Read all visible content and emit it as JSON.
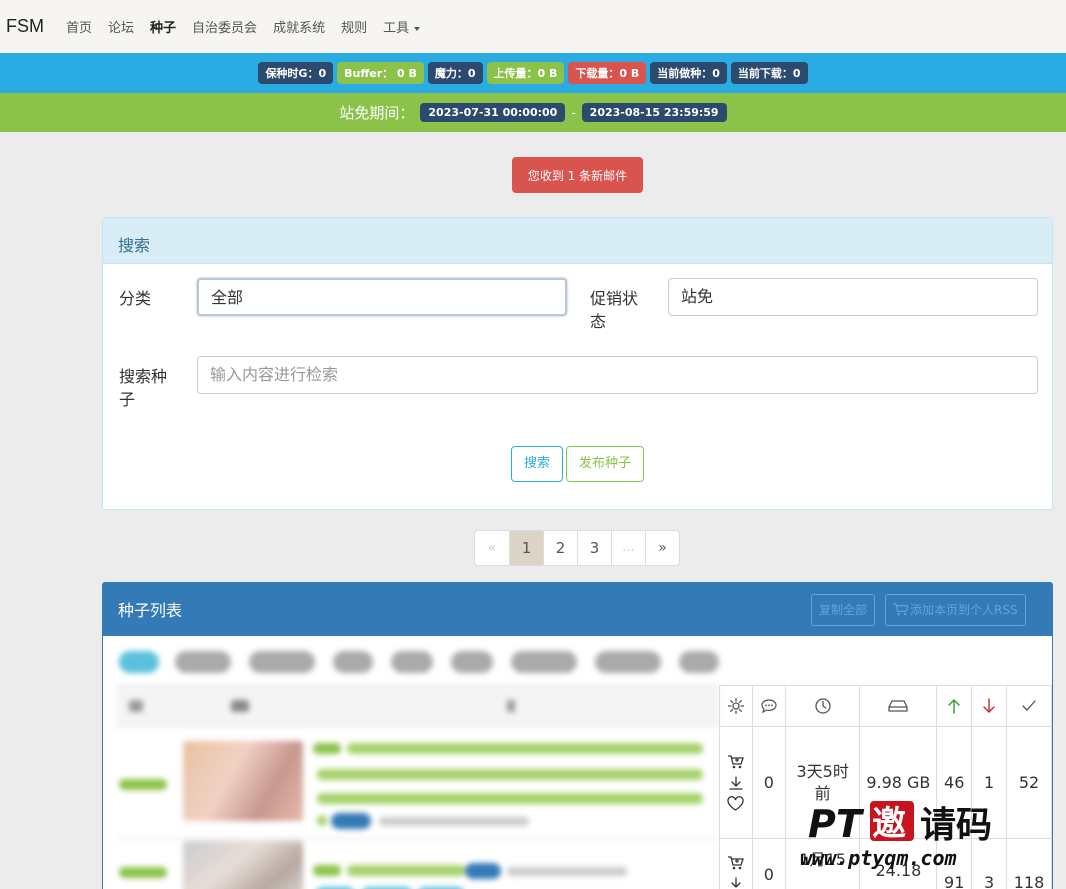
{
  "nav": {
    "brand": "FSM",
    "items": [
      {
        "label": "首页",
        "active": false
      },
      {
        "label": "论坛",
        "active": false
      },
      {
        "label": "种子",
        "active": true
      },
      {
        "label": "自治委员会",
        "active": false
      },
      {
        "label": "成就系统",
        "active": false
      },
      {
        "label": "规则",
        "active": false
      }
    ],
    "tools_label": "工具"
  },
  "stats": {
    "seed_time": "保种时G：0",
    "buffer": "Buffer：  0 B",
    "magic": "魔力：0",
    "upload": "上传量：0 B",
    "download": "下载量：0 B",
    "seeding": "当前做种：0",
    "leeching": "当前下载：0"
  },
  "free": {
    "label": "站免期间：",
    "start": "2023-07-31 00:00:00",
    "sep": "-",
    "end": "2023-08-15 23:59:59"
  },
  "mail": {
    "label": "您收到 1 条新邮件"
  },
  "search": {
    "title": "搜索",
    "category_label": "分类",
    "category_value": "全部",
    "promo_label_1": "促销状",
    "promo_label_2": "态",
    "promo_value": "站免",
    "keyword_label_1": "搜索种",
    "keyword_label_2": "子",
    "keyword_placeholder": "输入内容进行检索",
    "search_button": "搜索",
    "publish_button": "发布种子"
  },
  "pagination": {
    "prev": "«",
    "pages": [
      "1",
      "2",
      "3"
    ],
    "current": "1",
    "ellipsis": "...",
    "next": "»"
  },
  "torrent_list": {
    "title": "种子列表",
    "copy_all": "复制全部",
    "add_rss": "添加本页到个人RSS",
    "rows": [
      {
        "comments": "0",
        "age_1": "3天5时",
        "age_2": "前",
        "size": "9.98 GB",
        "seeders": "46",
        "leechers": "1",
        "completed": "52"
      },
      {
        "comments": "0",
        "age_1": "1月15",
        "age_2": "",
        "size": "24.18",
        "seeders": "91",
        "leechers": "3",
        "completed": "118"
      }
    ]
  },
  "watermark": {
    "line1": "PT邀请码",
    "line2": "www.ptyqm.com"
  }
}
